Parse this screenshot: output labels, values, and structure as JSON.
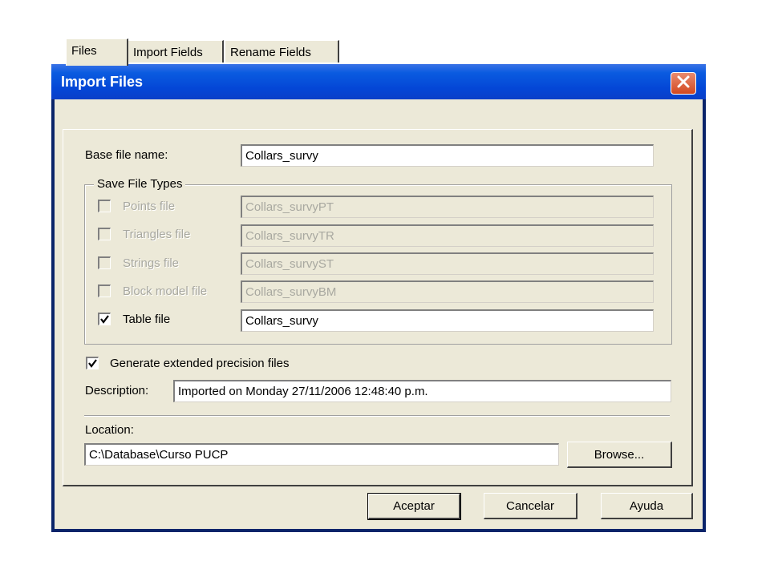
{
  "window": {
    "title": "Import Files",
    "close_icon": "close-icon"
  },
  "tabs": [
    {
      "label": "Files",
      "active": true
    },
    {
      "label": "Import Fields",
      "active": false
    },
    {
      "label": "Rename Fields",
      "active": false
    }
  ],
  "base_file": {
    "label": "Base file name:",
    "value": "Collars_survy"
  },
  "save_file_types": {
    "legend": "Save File Types",
    "items": [
      {
        "label": "Points file",
        "value": "Collars_survyPT",
        "checked": false,
        "enabled": false
      },
      {
        "label": "Triangles file",
        "value": "Collars_survyTR",
        "checked": false,
        "enabled": false
      },
      {
        "label": "Strings file",
        "value": "Collars_survyST",
        "checked": false,
        "enabled": false
      },
      {
        "label": "Block model file",
        "value": "Collars_survyBM",
        "checked": false,
        "enabled": false
      },
      {
        "label": "Table file",
        "value": "Collars_survy",
        "checked": true,
        "enabled": true
      }
    ]
  },
  "extended_precision": {
    "label": "Generate extended precision files",
    "checked": true
  },
  "description": {
    "label": "Description:",
    "value": "Imported on Monday 27/11/2006 12:48:40 p.m."
  },
  "location": {
    "label": "Location:",
    "value": "C:\\Database\\Curso PUCP",
    "browse_label": "Browse..."
  },
  "buttons": {
    "ok": "Aceptar",
    "cancel": "Cancelar",
    "help": "Ayuda"
  },
  "colors": {
    "titlebar": "#0a5be0",
    "dialog_bg": "#ece9d8",
    "close": "#d34820"
  }
}
